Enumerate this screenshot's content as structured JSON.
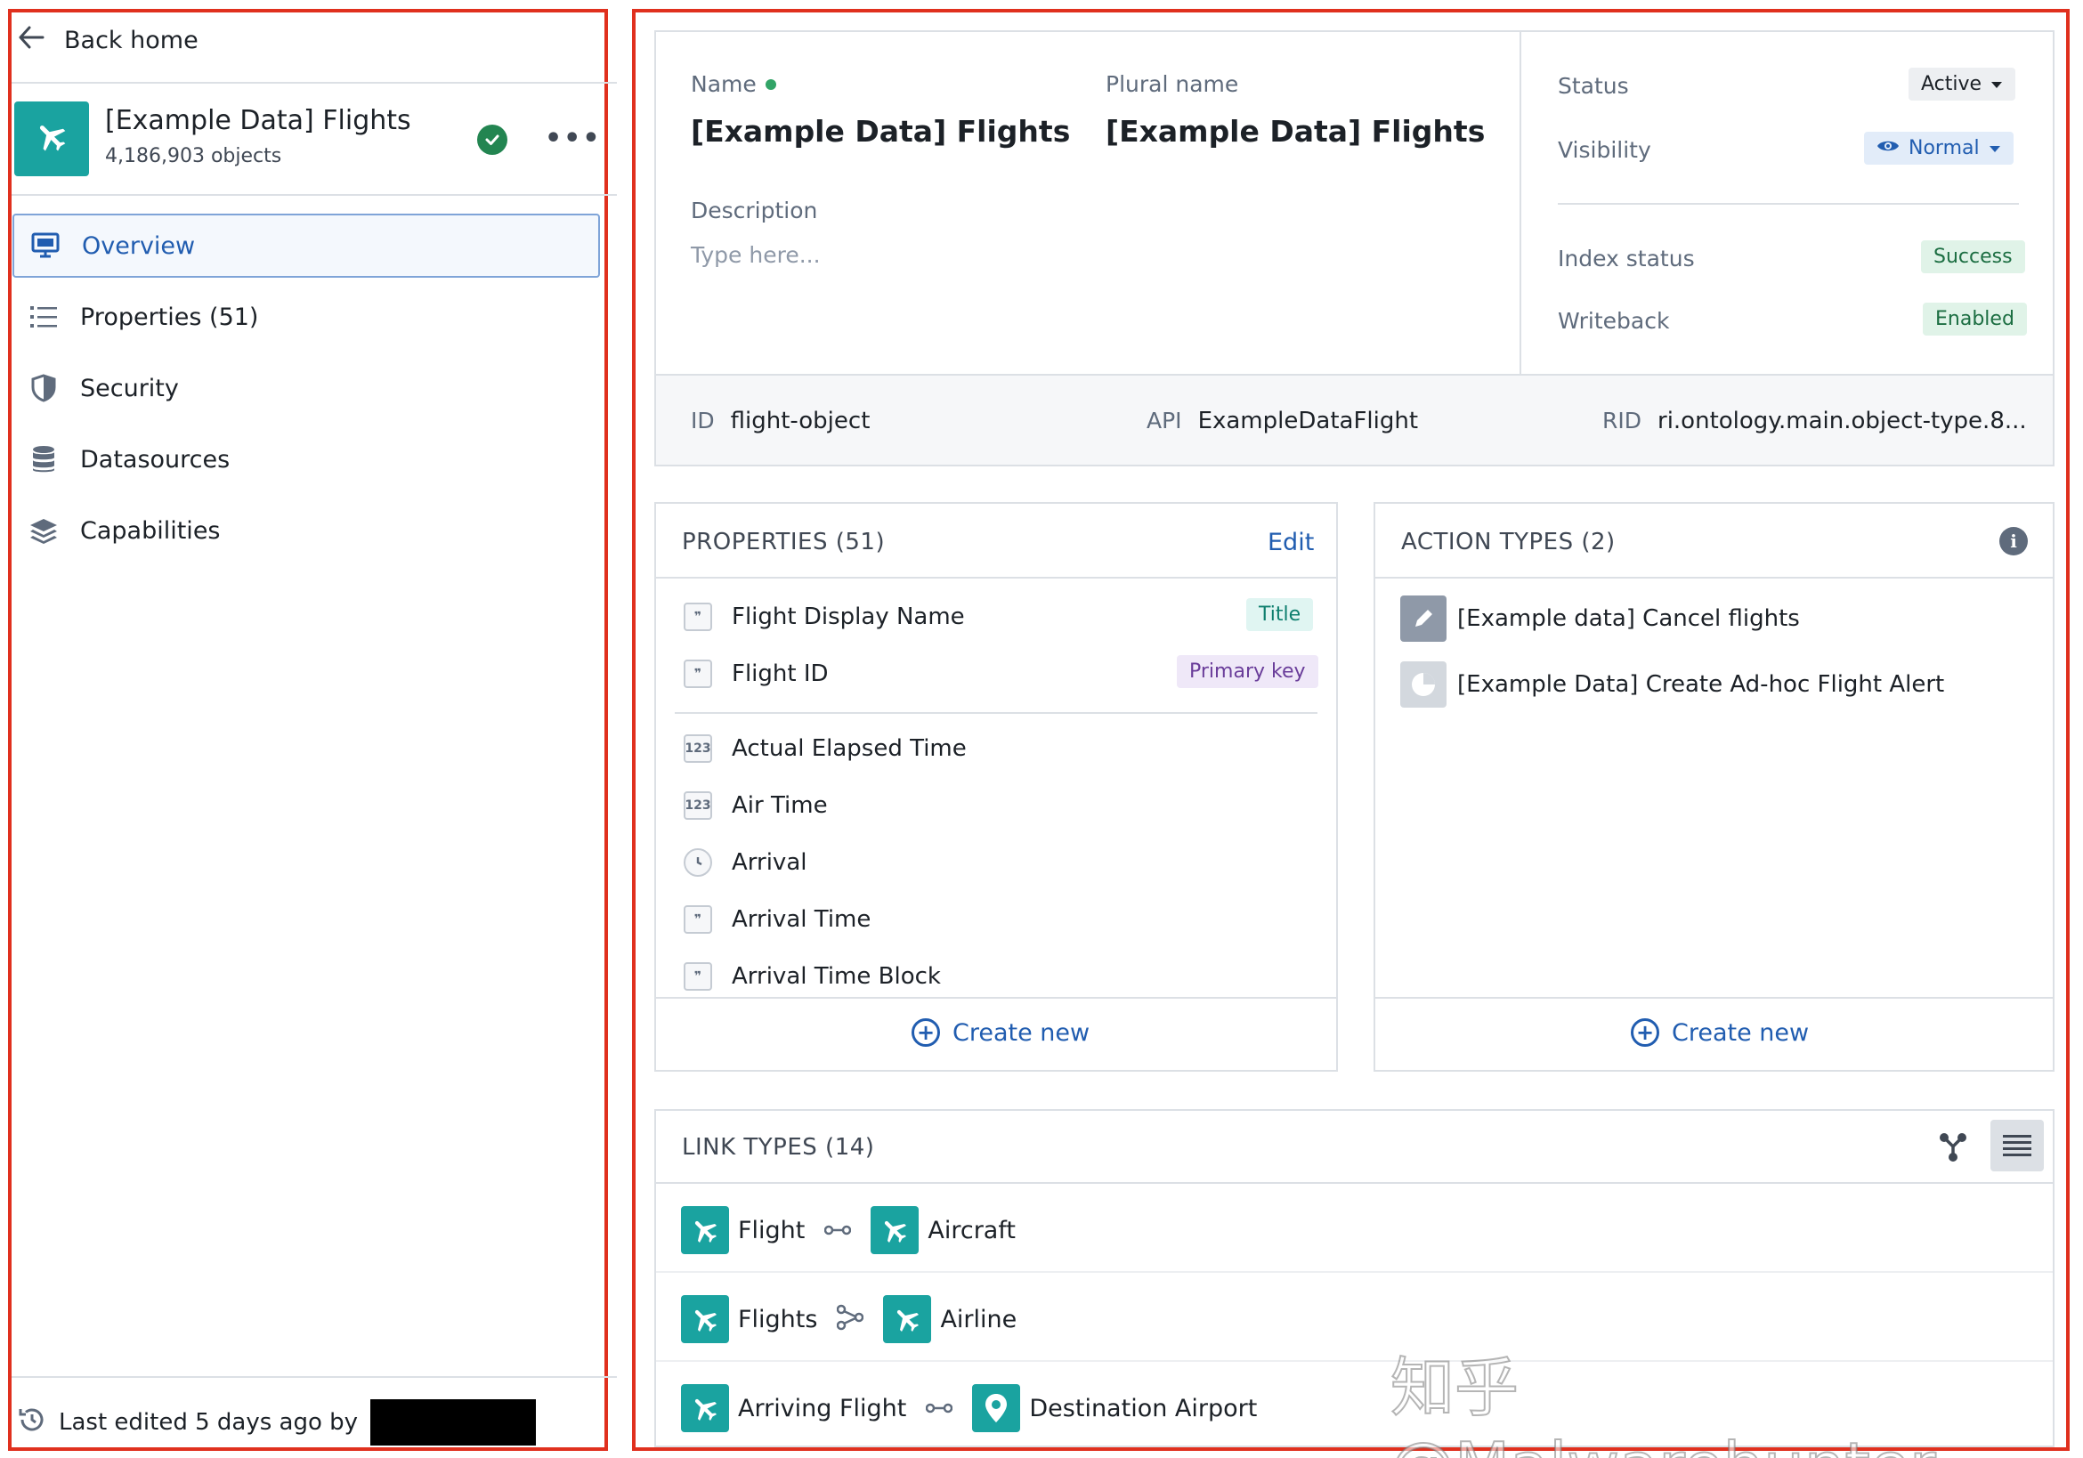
{
  "sidebar": {
    "back_label": "Back home",
    "object_title": "[Example Data] Flights",
    "object_count": "4,186,903 objects",
    "nav": [
      {
        "label": "Overview",
        "icon": "monitor-icon"
      },
      {
        "label": "Properties (51)",
        "icon": "list-icon"
      },
      {
        "label": "Security",
        "icon": "shield-icon"
      },
      {
        "label": "Datasources",
        "icon": "database-icon"
      },
      {
        "label": "Capabilities",
        "icon": "layers-icon"
      }
    ],
    "last_edited": "Last edited 5 days ago by"
  },
  "header": {
    "name_label": "Name",
    "name_value": "[Example Data] Flights",
    "plural_label": "Plural name",
    "plural_value": "[Example Data] Flights",
    "description_label": "Description",
    "description_placeholder": "Type here...",
    "status_label": "Status",
    "status_value": "Active",
    "visibility_label": "Visibility",
    "visibility_value": "Normal",
    "index_label": "Index status",
    "index_value": "Success",
    "writeback_label": "Writeback",
    "writeback_value": "Enabled",
    "id_label": "ID",
    "id_value": "flight-object",
    "api_label": "API",
    "api_value": "ExampleDataFlight",
    "rid_label": "RID",
    "rid_value": "ri.ontology.main.object-type.8..."
  },
  "properties": {
    "title": "PROPERTIES (51)",
    "edit_label": "Edit",
    "create_label": "Create new",
    "items": [
      {
        "label": "Flight Display Name",
        "type_glyph": "99",
        "tag": "Title"
      },
      {
        "label": "Flight ID",
        "type_glyph": "99",
        "tag": "Primary key"
      },
      {
        "label": "Actual Elapsed Time",
        "type_glyph": "123"
      },
      {
        "label": "Air Time",
        "type_glyph": "123"
      },
      {
        "label": "Arrival",
        "type_glyph": "clock"
      },
      {
        "label": "Arrival Time",
        "type_glyph": "99"
      },
      {
        "label": "Arrival Time Block",
        "type_glyph": "99"
      }
    ]
  },
  "actions": {
    "title": "ACTION TYPES (2)",
    "create_label": "Create new",
    "items": [
      {
        "label": "[Example data] Cancel flights",
        "icon": "pencil-icon"
      },
      {
        "label": "[Example Data] Create Ad-hoc Flight Alert",
        "icon": "pie-icon"
      }
    ]
  },
  "links": {
    "title": "LINK TYPES (14)",
    "rows": [
      {
        "left": "Flight",
        "right": "Aircraft",
        "connector": "one-to-one-icon",
        "right_icon": "airplane-icon"
      },
      {
        "left": "Flights",
        "right": "Airline",
        "connector": "many-to-one-icon",
        "right_icon": "airplane-icon"
      },
      {
        "left": "Arriving Flight",
        "right": "Destination Airport",
        "connector": "one-to-one-icon",
        "right_icon": "map-pin-icon"
      }
    ]
  },
  "watermark": "知乎 @Malwarehunter",
  "colors": {
    "accent": "#215db0",
    "teal": "#1aa3a0",
    "frame": "#e0301e",
    "success": "#238551"
  }
}
